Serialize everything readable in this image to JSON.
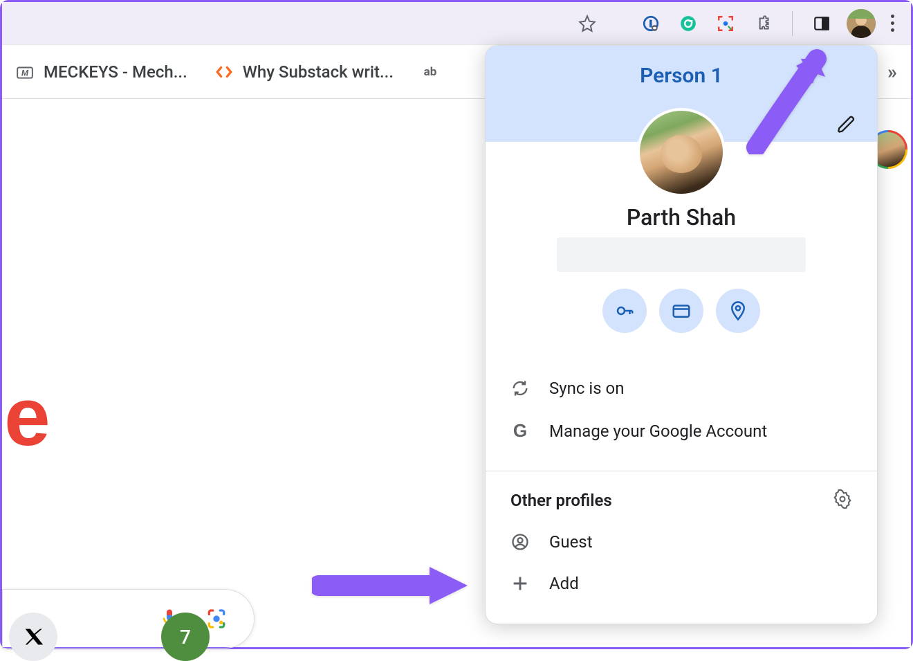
{
  "toolbar": {
    "star_icon": "star",
    "extensions": [
      "1password",
      "grammarly",
      "screenshot",
      "extensions-puzzle"
    ],
    "side_panel_icon": "side-panel",
    "menu_icon": "more-vert"
  },
  "bookmarks": {
    "items": [
      {
        "icon": "letter-m",
        "label": "MECKEYS - Mech..."
      },
      {
        "icon": "angle-brackets",
        "label": "Why Substack writ..."
      },
      {
        "icon": "abc",
        "label": ""
      }
    ],
    "overflow": "»"
  },
  "main": {
    "google_letter": "e"
  },
  "profile_panel": {
    "person_label": "Person 1",
    "user_name": "Parth Shah",
    "quick_actions": [
      "passwords",
      "payment-methods",
      "addresses"
    ],
    "menu": {
      "sync_label": "Sync is on",
      "manage_label": "Manage your Google Account"
    },
    "other_profiles": {
      "heading": "Other profiles",
      "guest_label": "Guest",
      "add_label": "Add"
    }
  },
  "annotations": {
    "arrow_color": "#8b5cf6"
  }
}
